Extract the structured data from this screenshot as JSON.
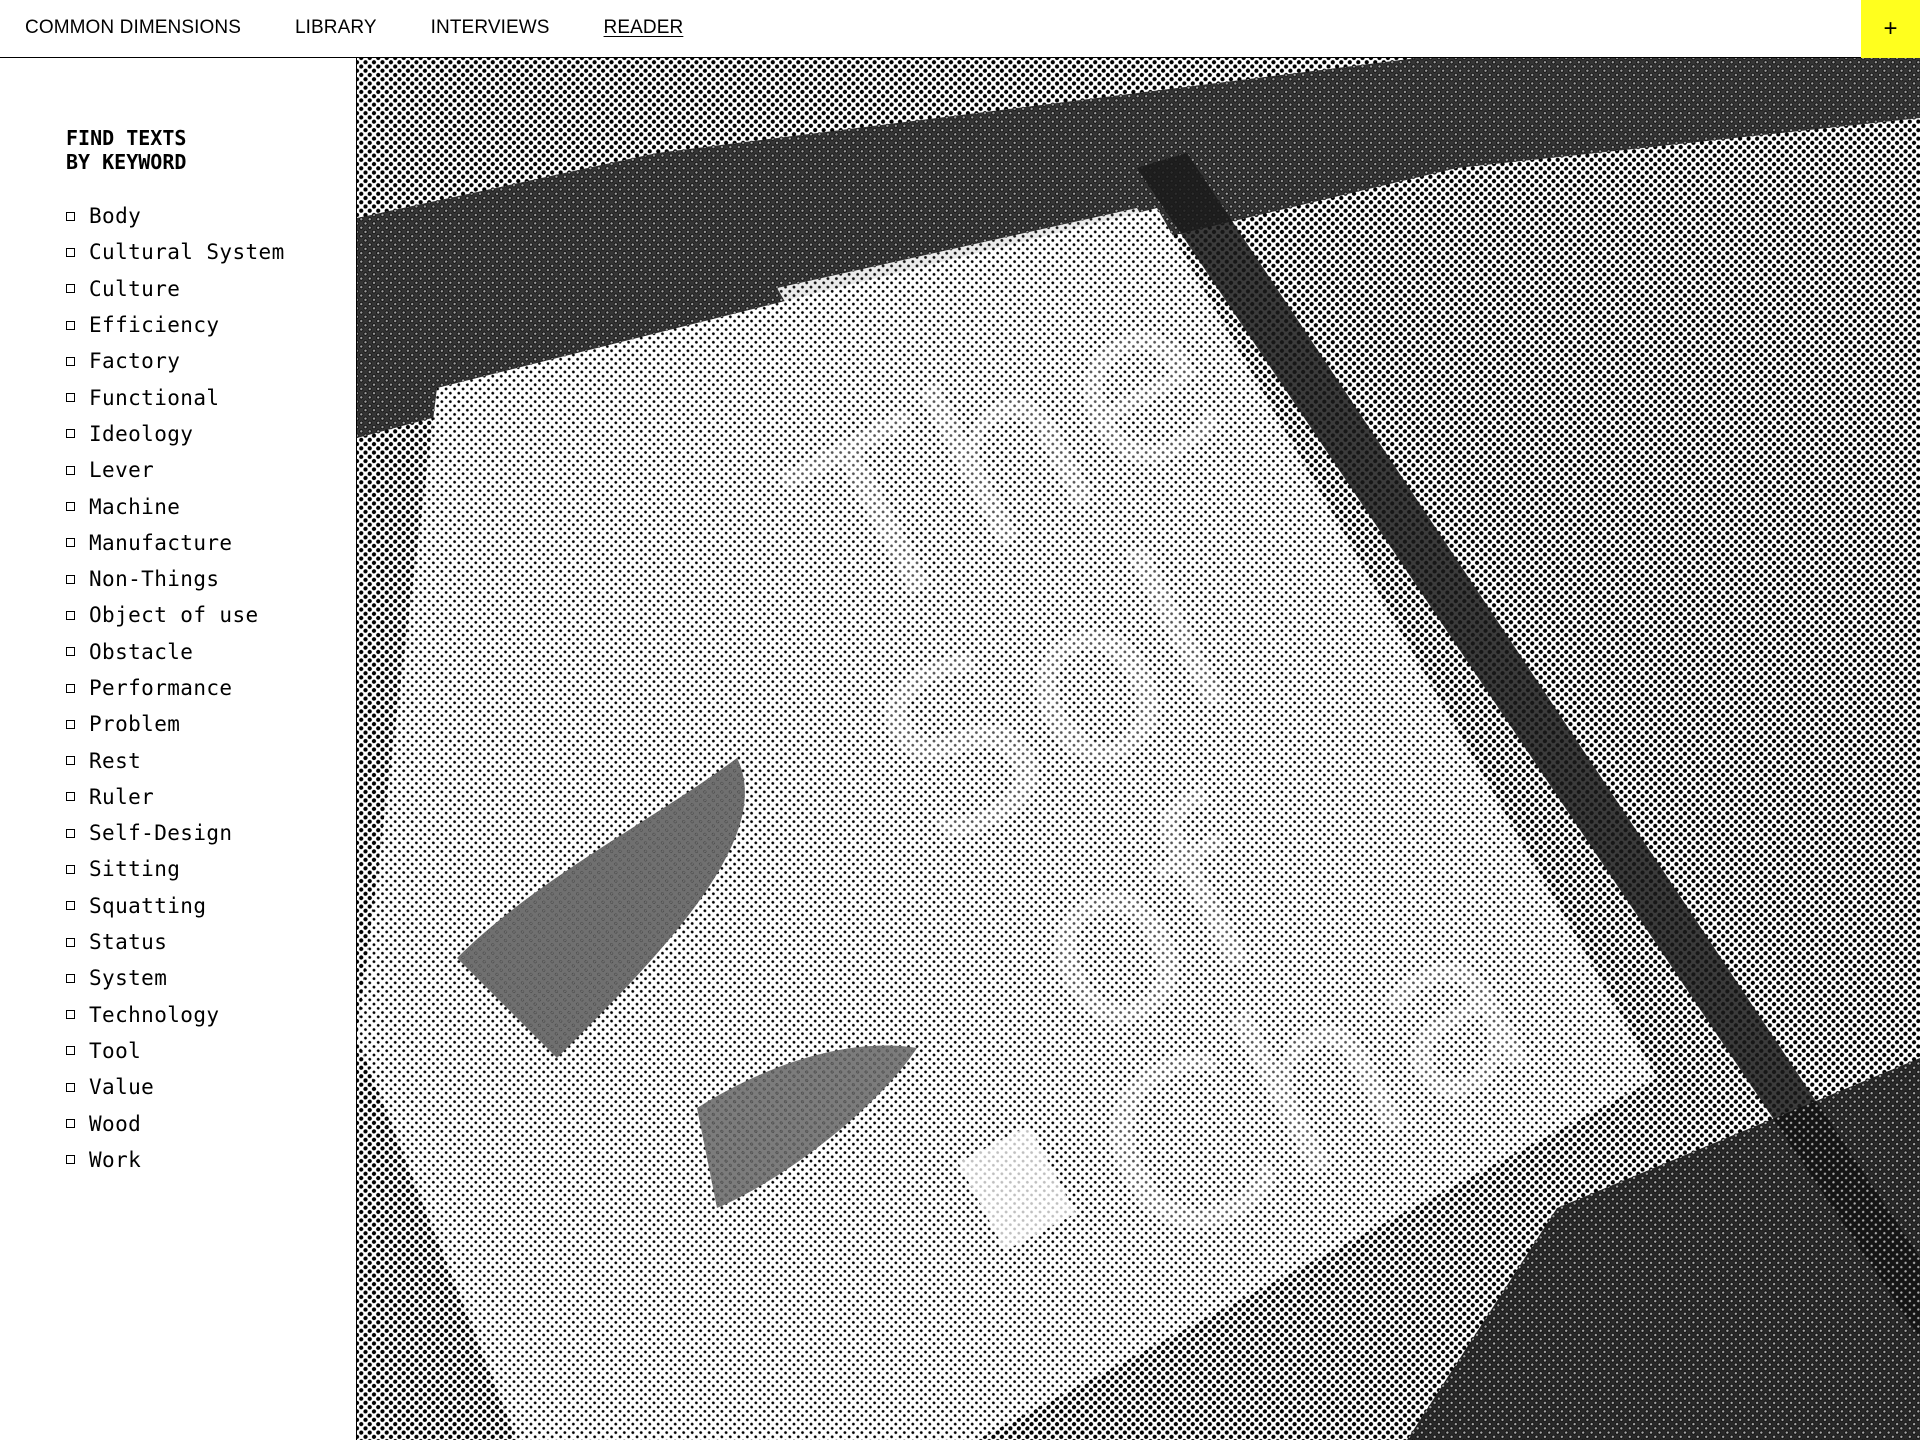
{
  "nav": {
    "items": [
      {
        "label": "COMMON DIMENSIONS",
        "active": false
      },
      {
        "label": "LIBRARY",
        "active": false
      },
      {
        "label": "INTERVIEWS",
        "active": false
      },
      {
        "label": "READER",
        "active": true
      }
    ],
    "plus_label": "+",
    "plus_color": "#ffff1e"
  },
  "sidebar": {
    "heading": "FIND TEXTS\nBY KEYWORD",
    "keywords": [
      "Body",
      "Cultural System",
      "Culture",
      "Efficiency",
      "Factory",
      "Functional",
      "Ideology",
      "Lever",
      "Machine",
      "Manufacture",
      "Non-Things",
      "Object of use",
      "Obstacle",
      "Performance",
      "Problem",
      "Rest",
      "Ruler",
      "Self-Design",
      "Sitting",
      "Squatting",
      "Status",
      "System",
      "Technology",
      "Tool",
      "Value",
      "Wood",
      "Work"
    ]
  },
  "hero": {
    "icon": "halftone-photo-book-on-table"
  }
}
